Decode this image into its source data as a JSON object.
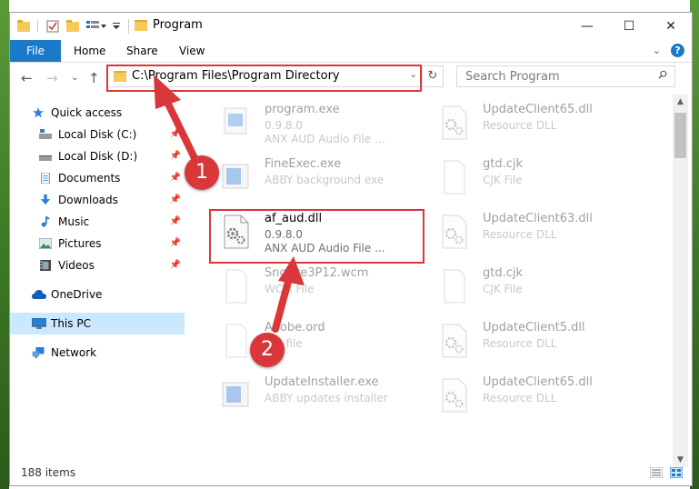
{
  "window": {
    "title": "Program",
    "controls": {
      "minimize": "—",
      "maximize": "☐",
      "close": "✕"
    }
  },
  "ribbon": {
    "tabs": [
      "File",
      "Home",
      "Share",
      "View"
    ],
    "help": "?"
  },
  "nav": {
    "address": "C:\\Program Files\\Program Directory",
    "search_placeholder": "Search Program"
  },
  "sidebar": {
    "items": [
      {
        "label": "Quick access",
        "icon": "star-icon"
      },
      {
        "label": "Local Disk (C:)",
        "icon": "drive-icon"
      },
      {
        "label": "Local Disk (D:)",
        "icon": "drive-icon"
      },
      {
        "label": "Documents",
        "icon": "documents-icon"
      },
      {
        "label": "Downloads",
        "icon": "downloads-icon"
      },
      {
        "label": "Music",
        "icon": "music-icon"
      },
      {
        "label": "Pictures",
        "icon": "pictures-icon"
      },
      {
        "label": "Videos",
        "icon": "videos-icon"
      },
      {
        "label": "OneDrive",
        "icon": "cloud-icon"
      },
      {
        "label": "This PC",
        "icon": "computer-icon"
      },
      {
        "label": "Network",
        "icon": "network-icon"
      }
    ]
  },
  "files": {
    "left": [
      {
        "name": "program.exe",
        "line2": "0.9.8.0",
        "line3": "ANX AUD Audio File ..."
      },
      {
        "name": "FineExec.exe",
        "line2": "ABBY background exe",
        "line3": ""
      },
      {
        "name": "af_aud.dll",
        "line2": "0.9.8.0",
        "line3": "ANX AUD Audio File ..."
      },
      {
        "name": "Snooze3P12.wcm",
        "line2": "WCM File",
        "line3": ""
      },
      {
        "name": "Adobe.ord",
        "line2": "ord file",
        "line3": ""
      },
      {
        "name": "UpdateInstaller.exe",
        "line2": "ABBY updates installer",
        "line3": ""
      }
    ],
    "right": [
      {
        "name": "UpdateClient65.dll",
        "line2": "Resource DLL",
        "line3": ""
      },
      {
        "name": "gtd.cjk",
        "line2": "CJK File",
        "line3": ""
      },
      {
        "name": "UpdateClient63.dll",
        "line2": "Resource DLL",
        "line3": ""
      },
      {
        "name": "gtd.cjk",
        "line2": "CJK File",
        "line3": ""
      },
      {
        "name": "UpdateClient5.dll",
        "line2": "Resource DLL",
        "line3": ""
      },
      {
        "name": "UpdateClient65.dll",
        "line2": "Resource DLL",
        "line3": ""
      }
    ]
  },
  "status": {
    "count": "188 items"
  },
  "annotations": {
    "step1": "1",
    "step2": "2"
  },
  "colors": {
    "accent": "#1979ca",
    "highlight": "#d9373a",
    "selected": "#cce8ff"
  }
}
